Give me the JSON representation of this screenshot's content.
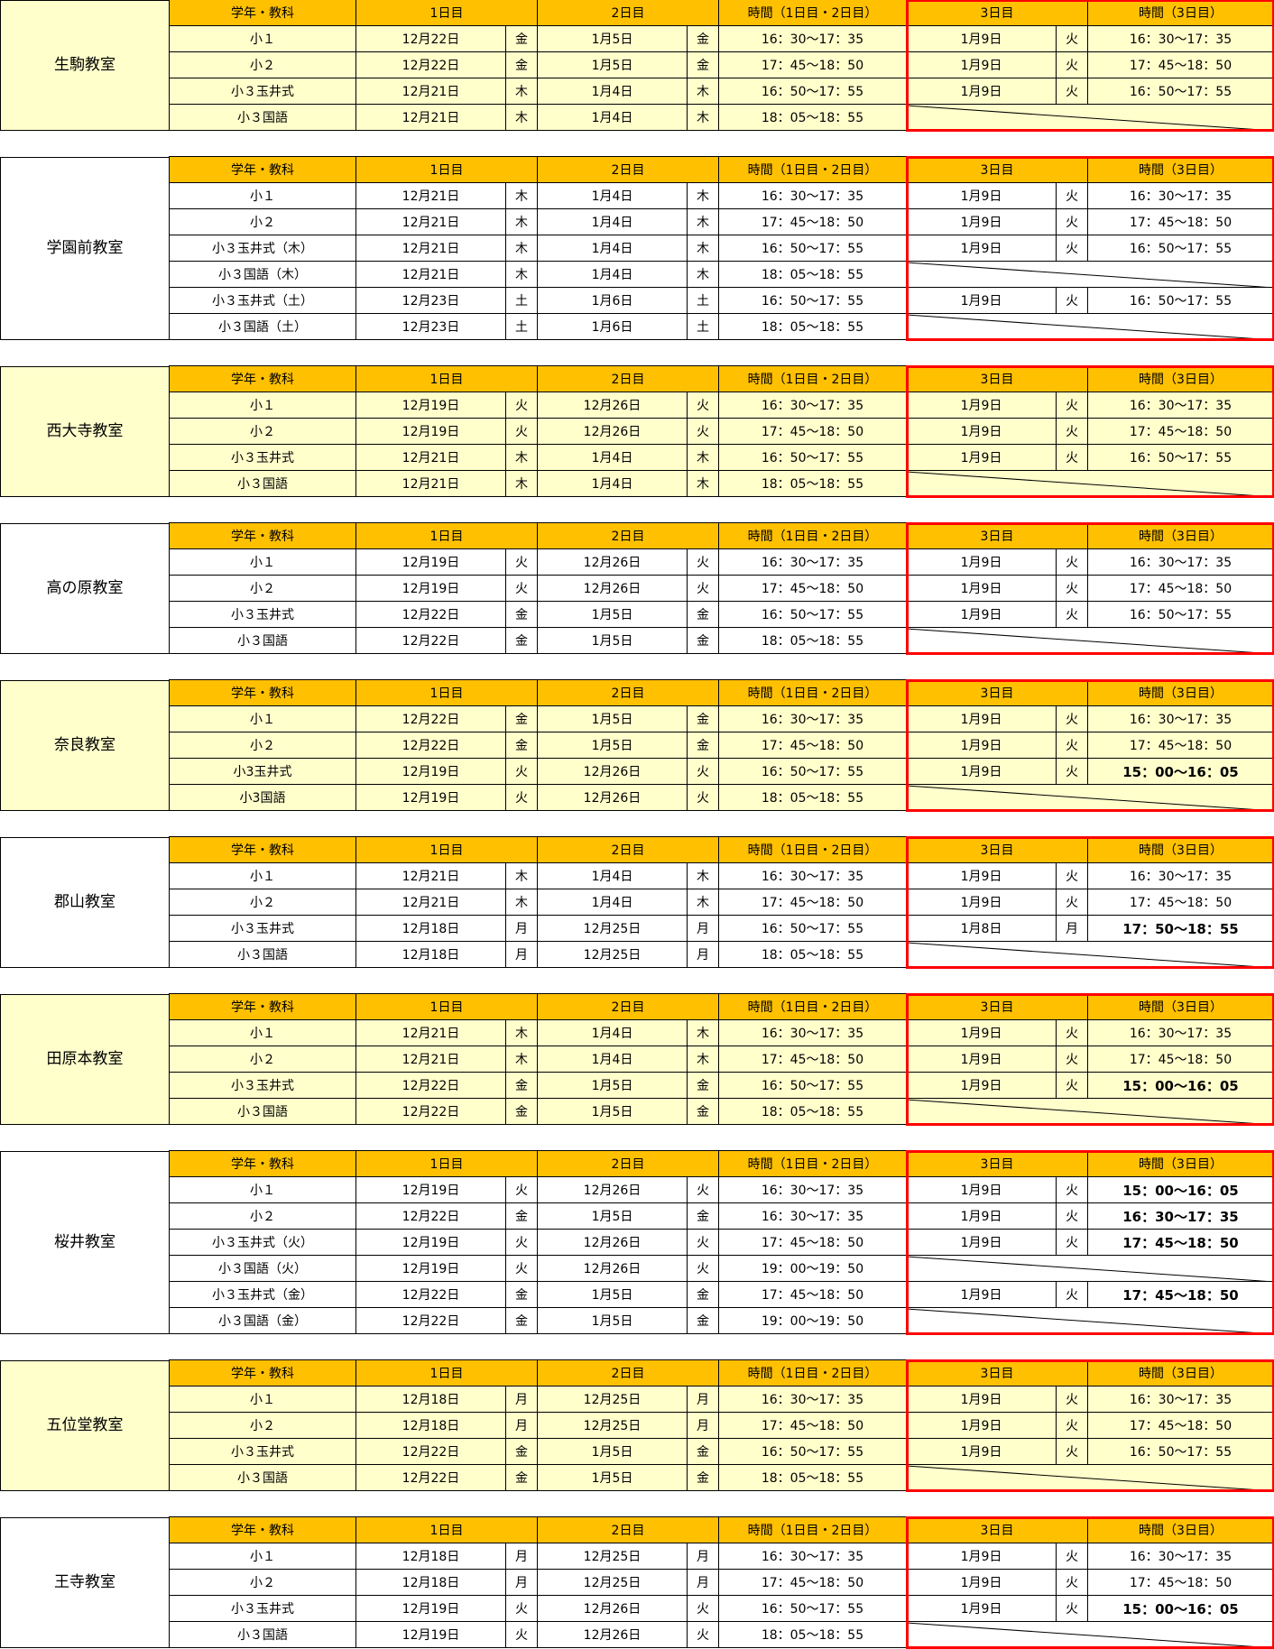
{
  "headers": [
    "学年・教科",
    "1日目",
    "2日目",
    "時間（1日目・2日目）",
    "3日目",
    "時間（3日目）"
  ],
  "colors": {
    "header": "#ffc000",
    "light_yellow": "#ffffcc",
    "white": "#ffffff",
    "highlight_border": "#ff0000"
  },
  "classrooms": [
    {
      "name": [
        "生駒",
        "教室"
      ],
      "bg": "y",
      "rows": [
        [
          "小１",
          "12月22日",
          "金",
          "1月5日",
          "金",
          "16：30～17：35",
          "1月9日",
          "火",
          "16：30～17：35",
          false
        ],
        [
          "小２",
          "12月22日",
          "金",
          "1月5日",
          "金",
          "17：45～18：50",
          "1月9日",
          "火",
          "17：45～18：50",
          false
        ],
        [
          "小３玉井式",
          "12月21日",
          "木",
          "1月4日",
          "木",
          "16：50～17：55",
          "1月9日",
          "火",
          "16：50～17：55",
          false
        ],
        [
          "小３国語",
          "12月21日",
          "木",
          "1月4日",
          "木",
          "18：05～18：55",
          null,
          null,
          null,
          false
        ]
      ]
    },
    {
      "name": [
        "学園前",
        "教室"
      ],
      "bg": "w",
      "rows": [
        [
          "小１",
          "12月21日",
          "木",
          "1月4日",
          "木",
          "16：30～17：35",
          "1月9日",
          "火",
          "16：30～17：35",
          false
        ],
        [
          "小２",
          "12月21日",
          "木",
          "1月4日",
          "木",
          "17：45～18：50",
          "1月9日",
          "火",
          "17：45～18：50",
          false
        ],
        [
          "小３玉井式（木）",
          "12月21日",
          "木",
          "1月4日",
          "木",
          "16：50～17：55",
          "1月9日",
          "火",
          "16：50～17：55",
          false
        ],
        [
          "小３国語（木）",
          "12月21日",
          "木",
          "1月4日",
          "木",
          "18：05～18：55",
          null,
          null,
          null,
          false
        ],
        [
          "小３玉井式（土）",
          "12月23日",
          "土",
          "1月6日",
          "土",
          "16：50～17：55",
          "1月9日",
          "火",
          "16：50～17：55",
          false
        ],
        [
          "小３国語（土）",
          "12月23日",
          "土",
          "1月6日",
          "土",
          "18：05～18：55",
          null,
          null,
          null,
          false
        ]
      ]
    },
    {
      "name": [
        "西大寺",
        "教室"
      ],
      "bg": "y",
      "rows": [
        [
          "小１",
          "12月19日",
          "火",
          "12月26日",
          "火",
          "16：30～17：35",
          "1月9日",
          "火",
          "16：30～17：35",
          false
        ],
        [
          "小２",
          "12月19日",
          "火",
          "12月26日",
          "火",
          "17：45～18：50",
          "1月9日",
          "火",
          "17：45～18：50",
          false
        ],
        [
          "小３玉井式",
          "12月21日",
          "木",
          "1月4日",
          "木",
          "16：50～17：55",
          "1月9日",
          "火",
          "16：50～17：55",
          false
        ],
        [
          "小３国語",
          "12月21日",
          "木",
          "1月4日",
          "木",
          "18：05～18：55",
          null,
          null,
          null,
          false
        ]
      ]
    },
    {
      "name": [
        "高の原",
        "教室"
      ],
      "bg": "w",
      "rows": [
        [
          "小１",
          "12月19日",
          "火",
          "12月26日",
          "火",
          "16：30～17：35",
          "1月9日",
          "火",
          "16：30～17：35",
          false
        ],
        [
          "小２",
          "12月19日",
          "火",
          "12月26日",
          "火",
          "17：45～18：50",
          "1月9日",
          "火",
          "17：45～18：50",
          false
        ],
        [
          "小３玉井式",
          "12月22日",
          "金",
          "1月5日",
          "金",
          "16：50～17：55",
          "1月9日",
          "火",
          "16：50～17：55",
          false
        ],
        [
          "小３国語",
          "12月22日",
          "金",
          "1月5日",
          "金",
          "18：05～18：55",
          null,
          null,
          null,
          false
        ]
      ]
    },
    {
      "name": [
        "奈良",
        "教室"
      ],
      "bg": "y",
      "rows": [
        [
          "小１",
          "12月22日",
          "金",
          "1月5日",
          "金",
          "16：30～17：35",
          "1月9日",
          "火",
          "16：30～17：35",
          false
        ],
        [
          "小２",
          "12月22日",
          "金",
          "1月5日",
          "金",
          "17：45～18：50",
          "1月9日",
          "火",
          "17：45～18：50",
          false
        ],
        [
          "小3玉井式",
          "12月19日",
          "火",
          "12月26日",
          "火",
          "16：50～17：55",
          "1月9日",
          "火",
          "15：00～16：05",
          true
        ],
        [
          "小3国語",
          "12月19日",
          "火",
          "12月26日",
          "火",
          "18：05～18：55",
          null,
          null,
          null,
          false
        ]
      ]
    },
    {
      "name": [
        "郡山",
        "教室"
      ],
      "bg": "w",
      "rows": [
        [
          "小１",
          "12月21日",
          "木",
          "1月4日",
          "木",
          "16：30～17：35",
          "1月9日",
          "火",
          "16：30～17：35",
          false
        ],
        [
          "小２",
          "12月21日",
          "木",
          "1月4日",
          "木",
          "17：45～18：50",
          "1月9日",
          "火",
          "17：45～18：50",
          false
        ],
        [
          "小３玉井式",
          "12月18日",
          "月",
          "12月25日",
          "月",
          "16：50～17：55",
          "1月8日",
          "月",
          "17：50～18：55",
          true
        ],
        [
          "小３国語",
          "12月18日",
          "月",
          "12月25日",
          "月",
          "18：05～18：55",
          null,
          null,
          null,
          false
        ]
      ]
    },
    {
      "name": [
        "田原本",
        "教室"
      ],
      "bg": "y",
      "rows": [
        [
          "小１",
          "12月21日",
          "木",
          "1月4日",
          "木",
          "16：30～17：35",
          "1月9日",
          "火",
          "16：30～17：35",
          false
        ],
        [
          "小２",
          "12月21日",
          "木",
          "1月4日",
          "木",
          "17：45～18：50",
          "1月9日",
          "火",
          "17：45～18：50",
          false
        ],
        [
          "小３玉井式",
          "12月22日",
          "金",
          "1月5日",
          "金",
          "16：50～17：55",
          "1月9日",
          "火",
          "15：00～16：05",
          true
        ],
        [
          "小３国語",
          "12月22日",
          "金",
          "1月5日",
          "金",
          "18：05～18：55",
          null,
          null,
          null,
          false
        ]
      ]
    },
    {
      "name": [
        "桜井",
        "教室"
      ],
      "bg": "w",
      "rows": [
        [
          "小１",
          "12月19日",
          "火",
          "12月26日",
          "火",
          "16：30～17：35",
          "1月9日",
          "火",
          "15：00～16：05",
          true
        ],
        [
          "小２",
          "12月22日",
          "金",
          "1月5日",
          "金",
          "16：30～17：35",
          "1月9日",
          "火",
          "16：30～17：35",
          true
        ],
        [
          "小３玉井式（火）",
          "12月19日",
          "火",
          "12月26日",
          "火",
          "17：45～18：50",
          "1月9日",
          "火",
          "17：45～18：50",
          true
        ],
        [
          "小３国語（火）",
          "12月19日",
          "火",
          "12月26日",
          "火",
          "19：00～19：50",
          null,
          null,
          null,
          false
        ],
        [
          "小３玉井式（金）",
          "12月22日",
          "金",
          "1月5日",
          "金",
          "17：45～18：50",
          "1月9日",
          "火",
          "17：45～18：50",
          true
        ],
        [
          "小３国語（金）",
          "12月22日",
          "金",
          "1月5日",
          "金",
          "19：00～19：50",
          null,
          null,
          null,
          false
        ]
      ]
    },
    {
      "name": [
        "五位堂",
        "教室"
      ],
      "bg": "y",
      "rows": [
        [
          "小１",
          "12月18日",
          "月",
          "12月25日",
          "月",
          "16：30～17：35",
          "1月9日",
          "火",
          "16：30～17：35",
          false
        ],
        [
          "小２",
          "12月18日",
          "月",
          "12月25日",
          "月",
          "17：45～18：50",
          "1月9日",
          "火",
          "17：45～18：50",
          false
        ],
        [
          "小３玉井式",
          "12月22日",
          "金",
          "1月5日",
          "金",
          "16：50～17：55",
          "1月9日",
          "火",
          "16：50～17：55",
          false
        ],
        [
          "小３国語",
          "12月22日",
          "金",
          "1月5日",
          "金",
          "18：05～18：55",
          null,
          null,
          null,
          false
        ]
      ]
    },
    {
      "name": [
        "王寺",
        "教室"
      ],
      "bg": "w",
      "rows": [
        [
          "小１",
          "12月18日",
          "月",
          "12月25日",
          "月",
          "16：30～17：35",
          "1月9日",
          "火",
          "16：30～17：35",
          false
        ],
        [
          "小２",
          "12月18日",
          "月",
          "12月25日",
          "月",
          "17：45～18：50",
          "1月9日",
          "火",
          "17：45～18：50",
          false
        ],
        [
          "小３玉井式",
          "12月19日",
          "火",
          "12月26日",
          "火",
          "16：50～17：55",
          "1月9日",
          "火",
          "15：00～16：05",
          true
        ],
        [
          "小３国語",
          "12月19日",
          "火",
          "12月26日",
          "火",
          "18：05～18：55",
          null,
          null,
          null,
          false
        ]
      ]
    }
  ]
}
